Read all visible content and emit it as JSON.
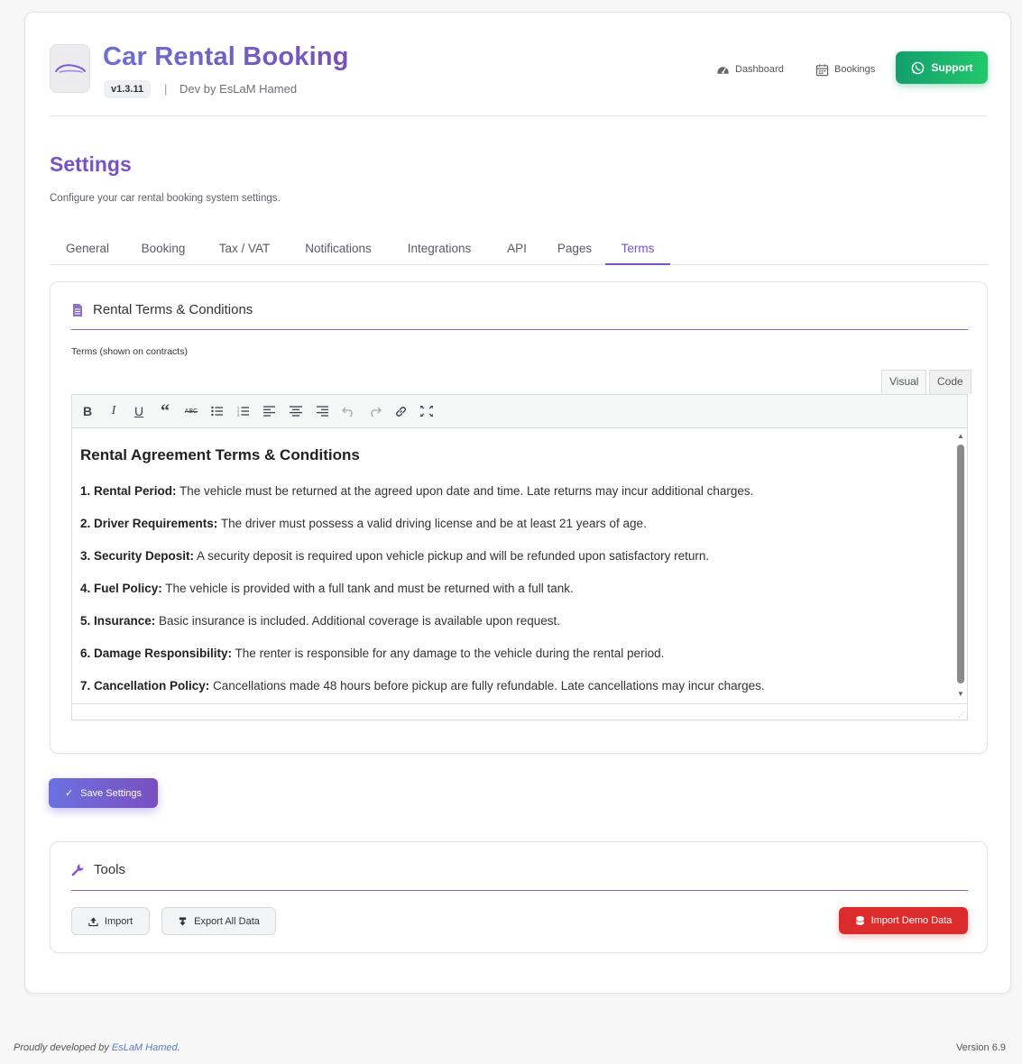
{
  "header": {
    "app_title": "Car Rental Booking",
    "version": "v1.3.11",
    "separator": "|",
    "dev_by": "Dev by EsLaM Hamed",
    "nav": {
      "dashboard": "Dashboard",
      "bookings": "Bookings",
      "support": "Support"
    }
  },
  "page": {
    "title": "Settings",
    "subtitle": "Configure your car rental booking system settings."
  },
  "tabs": [
    {
      "label": "General"
    },
    {
      "label": "Booking"
    },
    {
      "label": "Tax / VAT"
    },
    {
      "label": "Notifications"
    },
    {
      "label": "Integrations"
    },
    {
      "label": "API"
    },
    {
      "label": "Pages"
    },
    {
      "label": "Terms"
    }
  ],
  "active_tab": "Terms",
  "terms_panel": {
    "title": "Rental Terms & Conditions",
    "field_label": "Terms (shown on contracts)",
    "mode_visual": "Visual",
    "mode_code": "Code",
    "heading": "Rental Agreement Terms & Conditions",
    "items": [
      {
        "label": "1. Rental Period:",
        "text": " The vehicle must be returned at the agreed upon date and time. Late returns may incur additional charges."
      },
      {
        "label": "2. Driver Requirements:",
        "text": " The driver must possess a valid driving license and be at least 21 years of age."
      },
      {
        "label": "3. Security Deposit:",
        "text": " A security deposit is required upon vehicle pickup and will be refunded upon satisfactory return."
      },
      {
        "label": "4. Fuel Policy:",
        "text": " The vehicle is provided with a full tank and must be returned with a full tank."
      },
      {
        "label": "5. Insurance:",
        "text": " Basic insurance is included. Additional coverage is available upon request."
      },
      {
        "label": "6. Damage Responsibility:",
        "text": " The renter is responsible for any damage to the vehicle during the rental period."
      },
      {
        "label": "7. Cancellation Policy:",
        "text": " Cancellations made 48 hours before pickup are fully refundable. Late cancellations may incur charges."
      }
    ]
  },
  "save_button": "Save Settings",
  "tools_panel": {
    "title": "Tools",
    "import": "Import",
    "export": "Export All Data",
    "import_demo": "Import Demo Data"
  },
  "footer": {
    "prefix": "Proudly developed by ",
    "author": "EsLaM Hamed",
    "suffix": ".",
    "version": "Version 6.9"
  },
  "colors": {
    "accent": "#7a52c4",
    "support_green": "#1bb56d",
    "danger": "#dc2b2b"
  }
}
